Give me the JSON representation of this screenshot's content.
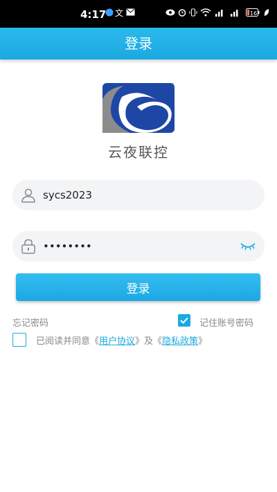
{
  "status_bar": {
    "time": "4:17",
    "battery": "16",
    "icons": [
      "notification-icon",
      "translate-icon",
      "mail-icon",
      "eye-icon",
      "alarm-icon",
      "vibrate-icon",
      "wifi-icon",
      "signal-icon",
      "signal-icon",
      "battery-icon",
      "leaf-icon"
    ]
  },
  "header": {
    "title": "登录"
  },
  "logo": {
    "text": "云夜联控"
  },
  "form": {
    "username_value": "sycs2023",
    "password_value": "sycs2023",
    "login_label": "登录",
    "forgot_label": "忘记密码",
    "remember_label": "记住账号密码",
    "remember_checked": true,
    "agree_checked": false,
    "agree_prefix": "已阅读并同意《",
    "user_agreement": "用户协议",
    "middle": "》及《",
    "privacy_policy": "隐私政策",
    "suffix": "》"
  },
  "colors": {
    "accent": "#1ba9e1",
    "logo_blue": "#1e47a5",
    "logo_gray": "#8c8c8c"
  }
}
